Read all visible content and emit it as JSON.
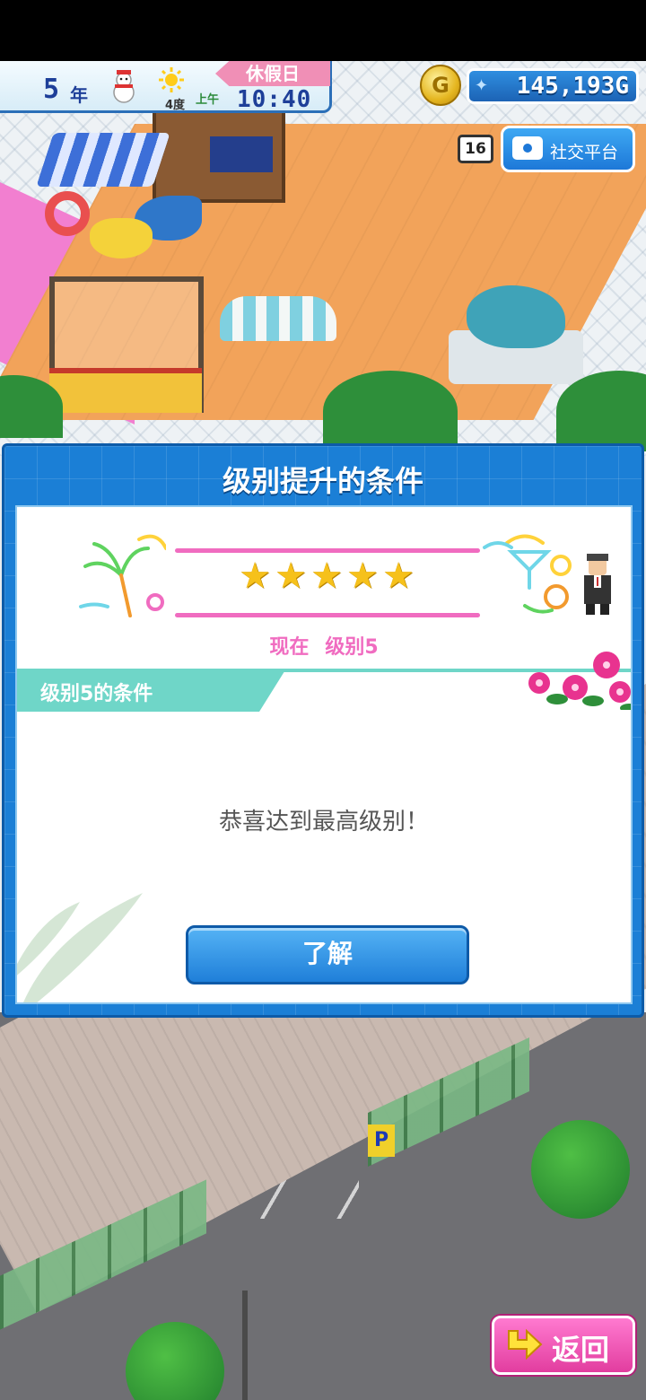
{
  "hud": {
    "year_number": "5",
    "year_unit": "年",
    "holiday": "休假日",
    "temperature": "4度",
    "am_pm": "上午",
    "time": "10:40",
    "money": "145,193G",
    "money_icon_char": "G",
    "age_rating": "16",
    "social_button_label": "社交平台"
  },
  "dialog": {
    "title": "级别提升的条件",
    "stars": [
      "★",
      "★",
      "★",
      "★",
      "★"
    ],
    "current_label": "现在",
    "current_level": "级别5",
    "condition_tab": "级别5的条件",
    "message": "恭喜达到最高级别！",
    "ok_label": "了解"
  },
  "back_button": {
    "label": "返回"
  },
  "world": {
    "parking_sign": "P"
  },
  "colors": {
    "dialog_blue": "#1b7fd6",
    "pink_accent": "#f06cc0",
    "teal_tab": "#6fd6c8",
    "back_pink": "#e23d9f"
  },
  "icons": [
    "snowman-icon",
    "sun-icon",
    "coin-icon",
    "camera-icon",
    "back-arrow-icon",
    "star-icon"
  ]
}
